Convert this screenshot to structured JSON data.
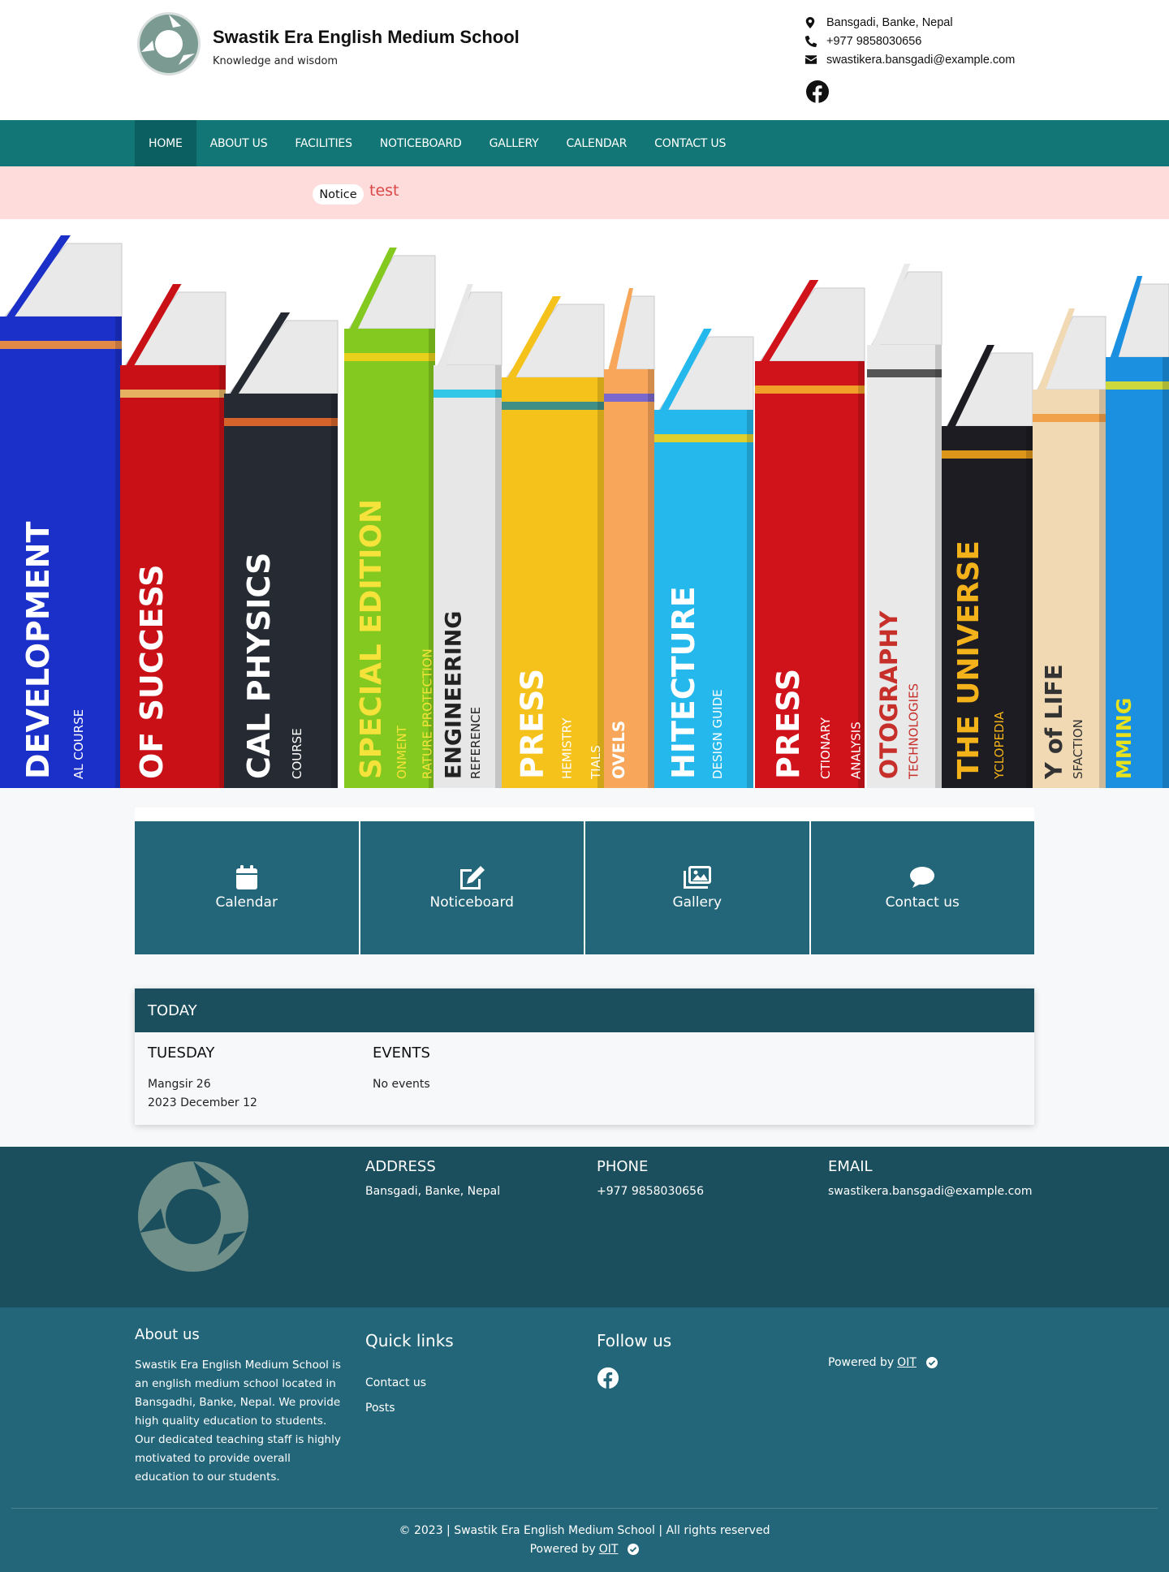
{
  "header": {
    "school_name": "Swastik Era English Medium School",
    "tagline": "Knowledge and wisdom",
    "address": "Bansgadi, Banke, Nepal",
    "phone": "+977 9858030656",
    "email": "swastikera.bansgadi@example.com"
  },
  "nav": {
    "items": [
      "HOME",
      "ABOUT US",
      "FACILITIES",
      "NOTICEBOARD",
      "GALLERY",
      "CALENDAR",
      "CONTACT US"
    ]
  },
  "notice": {
    "badge": "Notice",
    "text": "test"
  },
  "hero": {
    "book_titles": [
      "DEVELOPMENT",
      "AL COURSE",
      "OF SUCCESS",
      "CAL PHYSICS",
      "COURSE",
      "SPECIAL EDITION",
      "ONMENT",
      "RATURE PROTECTION",
      "ENGINEERING",
      "REFERENCE",
      "PRESS",
      "HEMISTRY",
      "TIALS",
      "OVELS",
      "HITECTURE",
      "DESIGN GUIDE",
      "PRESS",
      "CTIONARY",
      "ANALYSIS",
      "OTOGRAPHY",
      "TECHNOLOGIES",
      "THE UNIVERSE",
      "YCLOPEDIA",
      "Y of LIFE",
      "SFACTION",
      "MMING"
    ]
  },
  "tiles": [
    {
      "label": "Calendar",
      "icon": "calendar-icon"
    },
    {
      "label": "Noticeboard",
      "icon": "edit-icon"
    },
    {
      "label": "Gallery",
      "icon": "images-icon"
    },
    {
      "label": "Contact us",
      "icon": "chat-icon"
    }
  ],
  "today": {
    "heading": "TODAY",
    "day": "TUESDAY",
    "nepali_date": "Mangsir 26",
    "english_date": "2023 December 12",
    "events_heading": "EVENTS",
    "events_text": "No events"
  },
  "footer": {
    "address_h": "ADDRESS",
    "address": "Bansgadi, Banke, Nepal",
    "phone_h": "PHONE",
    "phone": "+977 9858030656",
    "email_h": "EMAIL",
    "email": "swastikera.bansgadi@example.com",
    "about_h": "About us",
    "about_p": "Swastik Era English Medium School is an english medium school located in Bansgadhi, Banke, Nepal. We provide high quality education to students. Our dedicated teaching staff is highly motivated to provide overall education to our students.",
    "quick_h": "Quick links",
    "quick_1": "Contact us",
    "quick_2": "Posts",
    "follow_h": "Follow us",
    "powered_prefix": "Powered by",
    "powered_link": "OIT",
    "copyright": "© 2023 | Swastik Era English Medium School | All rights reserved"
  },
  "colors": {
    "nav": "#127676",
    "nav_active": "#0c5f60",
    "notice_bg": "#fedcdc",
    "tile": "#236679",
    "footer_dark": "#1c4f5e",
    "footer": "#236679"
  }
}
